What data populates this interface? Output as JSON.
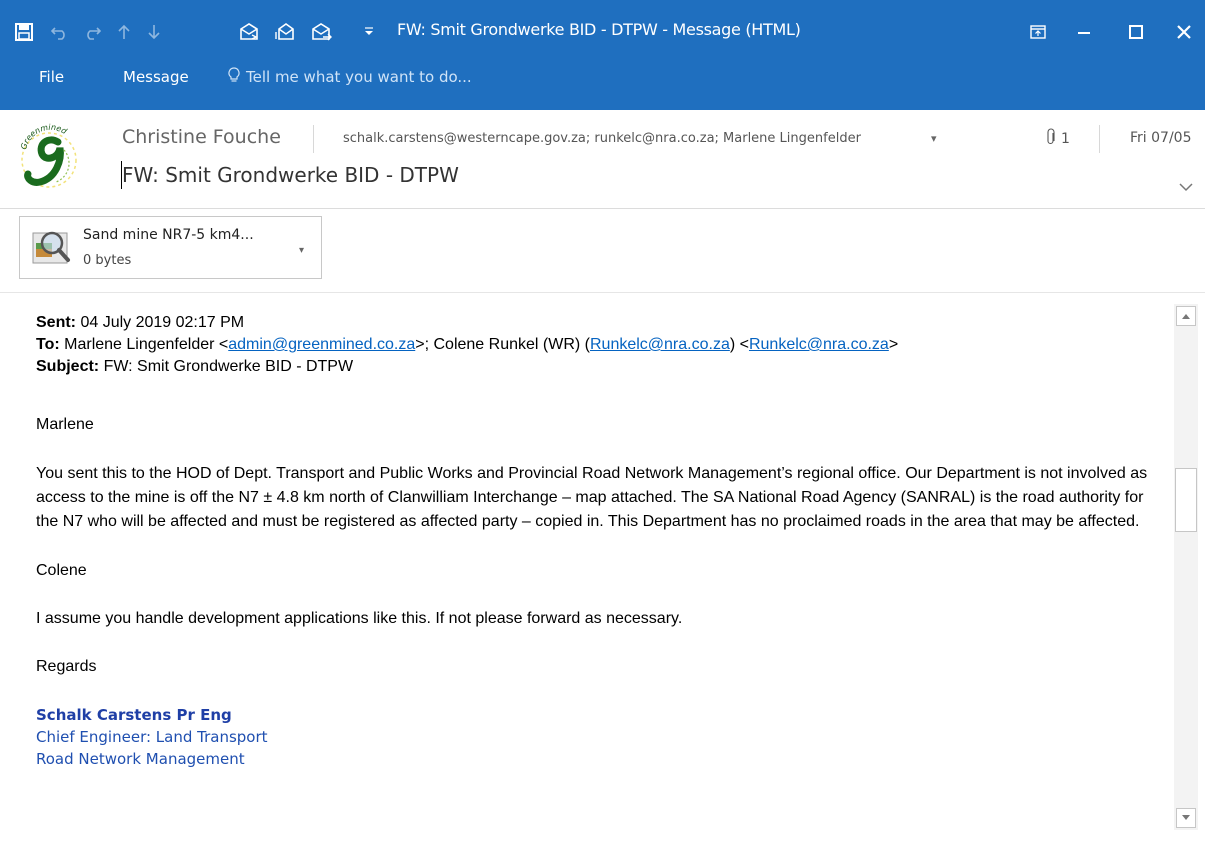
{
  "window": {
    "title": "FW: Smit Grondwerke BID - DTPW - Message (HTML)"
  },
  "menu": {
    "file": "File",
    "message": "Message",
    "tell_me": "Tell me what you want to do..."
  },
  "header": {
    "sender": "Christine Fouche",
    "recipients": "schalk.carstens@westerncape.gov.za; runkelc@nra.co.za; Marlene Lingenfelder",
    "attachment_count": "1",
    "date": "Fri 07/05",
    "subject": "FW: Smit Grondwerke BID - DTPW"
  },
  "attachment": {
    "name": "Sand mine NR7-5 km4...",
    "size": "0 bytes"
  },
  "email": {
    "sent_label": "Sent:",
    "sent_value": " 04 July 2019 02:17 PM",
    "to_label": "To:",
    "to_part1": " Marlene Lingenfelder <",
    "to_link1": "admin@greenmined.co.za",
    "to_part2": ">; Colene Runkel (WR) (",
    "to_link2": "Runkelc@nra.co.za",
    "to_part3": ") <",
    "to_link3": "Runkelc@nra.co.za",
    "to_part4": ">",
    "subject_label": "Subject:",
    "subject_value": " FW: Smit Grondwerke BID - DTPW",
    "greeting": "Marlene",
    "paragraph1": "You sent this to the HOD of Dept. Transport and Public Works and Provincial Road Network Management’s regional office. Our Department is not involved as access to the mine is off the N7 ± 4.8 km north of Clanwilliam Interchange – map attached. The SA National Road Agency (SANRAL) is the road authority for the N7 who will be affected and must be registered as affected party – copied in. This Department has no proclaimed roads in the area that may be affected.",
    "greeting2": "Colene",
    "paragraph2": "I assume you handle development applications like this. If not please forward as necessary.",
    "closing": "Regards",
    "sig_name": "Schalk Carstens Pr Eng",
    "sig_title": "Chief Engineer: Land Transport",
    "sig_dept": "Road Network Management"
  },
  "logo_text": "Greenmined",
  "colors": {
    "titlebar": "#1f6fbf",
    "link": "#0563c1",
    "signature": "#1f4fb0"
  }
}
